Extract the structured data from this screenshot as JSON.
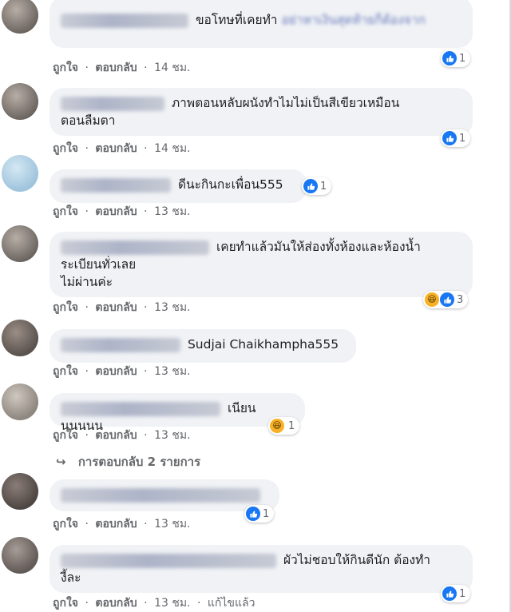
{
  "meta": {
    "like": "ถูกใจ",
    "reply": "ตอบกลับ",
    "sep": "·",
    "edited": "แก้ไขแล้ว"
  },
  "comments": [
    {
      "text": "ขอโทษที่เคยทำ",
      "text_tail": "อย่าหาเงินสุดท้ายก็ต้องจาก",
      "time": "14 ชม.",
      "reactions": "1"
    },
    {
      "text": "ภาพตอนหลับผนังทำไมไม่เป็นสีเขียวเหมือน",
      "text2": "ตอนลืมตา",
      "time": "14 ชม.",
      "reactions": "1"
    },
    {
      "text": "ดีนะกินกะเพื่อน555",
      "time": "13 ชม.",
      "reactions": "1"
    },
    {
      "text": "เคยทำแล้วมันให้ส่องทั้งห้องและห้องน้ำ",
      "text2": "ระเบียนทั่วเลย",
      "text3": "ไม่ผ่านค่ะ",
      "time": "13 ชม.",
      "reactions": "3"
    },
    {
      "text": "Sudjai Chaikhampha555",
      "time": "13 ชม."
    },
    {
      "text": "เนียนนนนนน",
      "time": "13 ชม.",
      "reactions": "1"
    },
    {
      "time": "13 ชม.",
      "reactions": "1"
    },
    {
      "text": "ผัวไม่ชอบให้กินดีนัก ต้องทำ",
      "text2": "งี้ละ",
      "time": "13 ชม.",
      "reactions": "1"
    }
  ],
  "replies": {
    "label": "การตอบกลับ 2 รายการ"
  },
  "colors": {
    "like": "#1877f2",
    "haha": "#f7b125",
    "bubble": "#f0f2f5",
    "meta": "#65676b"
  }
}
